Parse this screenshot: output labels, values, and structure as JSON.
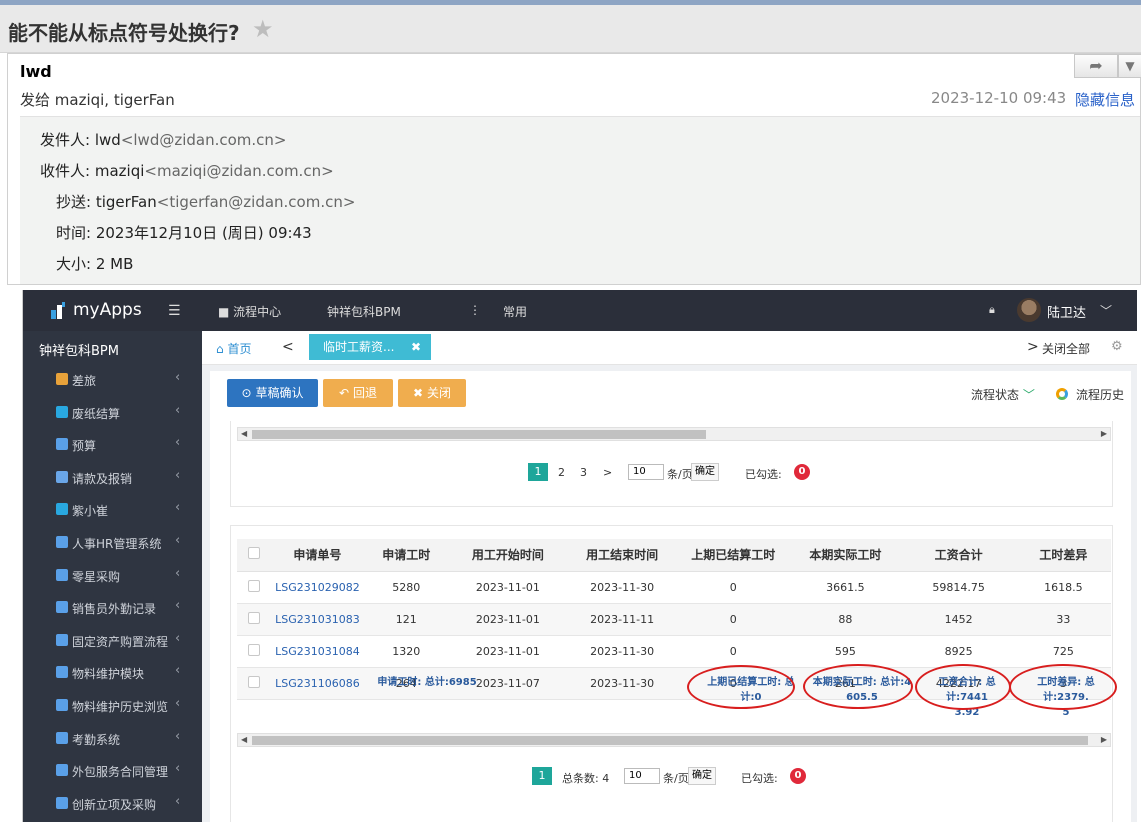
{
  "email": {
    "subject": "能不能从标点符号处换行?",
    "sender_name": "lwd",
    "recipients_line": "发给 maziqi, tigerFan",
    "date": "2023-12-10 09:43",
    "hide_info": "隐藏信息",
    "details": {
      "from_label": "发件人:",
      "from_name": "lwd",
      "from_addr": "<lwd@zidan.com.cn>",
      "to_label": "收件人:",
      "to_name": "maziqi",
      "to_addr": "<maziqi@zidan.com.cn>",
      "cc_label": "抄送:",
      "cc_name": "tigerFan",
      "cc_addr": "<tigerfan@zidan.com.cn>",
      "time_label": "时间:",
      "time_value": "2023年12月10日 (周日) 09:43",
      "size_label": "大小:",
      "size_value": "2 MB"
    }
  },
  "app": {
    "brand": "myApps",
    "nav": [
      "流程中心",
      "钟祥包科BPM",
      "常用"
    ],
    "user": "陆卫达",
    "sidebar_title": "钟祥包科BPM",
    "sidebar_items": [
      {
        "label": "差旅",
        "color": "#e8a23a"
      },
      {
        "label": "废纸结算",
        "color": "#29a8e0"
      },
      {
        "label": "预算",
        "color": "#5aa0e8"
      },
      {
        "label": "请款及报销",
        "color": "#6aa6e8"
      },
      {
        "label": "紫小崔",
        "color": "#29a8e0"
      },
      {
        "label": "人事HR管理系统",
        "color": "#5aa0e8"
      },
      {
        "label": "零星采购",
        "color": "#5aa0e8"
      },
      {
        "label": "销售员外勤记录",
        "color": "#5aa0e8"
      },
      {
        "label": "固定资产购置流程",
        "color": "#5aa0e8"
      },
      {
        "label": "物料维护模块",
        "color": "#5aa0e8"
      },
      {
        "label": "物料维护历史浏览",
        "color": "#5aa0e8"
      },
      {
        "label": "考勤系统",
        "color": "#5aa0e8"
      },
      {
        "label": "外包服务合同管理",
        "color": "#5aa0e8"
      },
      {
        "label": "创新立项及采购",
        "color": "#5aa0e8"
      }
    ],
    "tabs": {
      "home": "首页",
      "active": "临时工薪资...",
      "close_all": "关闭全部"
    },
    "toolbar": {
      "confirm": "草稿确认",
      "back": "回退",
      "close": "关闭",
      "flow_status": "流程状态",
      "flow_history": "流程历史"
    },
    "pager_top": {
      "pages": [
        "1",
        "2",
        "3"
      ],
      "next": ">",
      "page_size": "10",
      "per_page": "条/页",
      "ok": "确定",
      "selected_label": "已勾选:",
      "selected_count": "0"
    },
    "table": {
      "headers": [
        "申请单号",
        "申请工时",
        "用工开始时间",
        "用工结束时间",
        "上期已结算工时",
        "本期实际工时",
        "工资合计",
        "工时差异"
      ],
      "rows": [
        [
          "LSG231029082",
          "5280",
          "2023-11-01",
          "2023-11-30",
          "0",
          "3661.5",
          "59814.75",
          "1618.5"
        ],
        [
          "LSG231031083",
          "121",
          "2023-11-01",
          "2023-11-11",
          "0",
          "88",
          "1452",
          "33"
        ],
        [
          "LSG231031084",
          "1320",
          "2023-11-01",
          "2023-11-30",
          "0",
          "595",
          "8925",
          "725"
        ],
        [
          "LSG231106086",
          "264",
          "2023-11-07",
          "2023-11-30",
          "0",
          "261",
          "4222.17",
          "3"
        ]
      ],
      "summary": {
        "apply_hours_line1": "申请工时: 总计:6985",
        "prev_line1": "上期已结算工时: 总",
        "prev_line2": "计:0",
        "actual_line1": "本期实际工时: 总计:4",
        "actual_line2": "605.5",
        "wage_line1": "工资合计: 总计:7441",
        "wage_line2": "3.92",
        "diff_line1": "工时差异: 总计:2379.",
        "diff_line2": "5"
      }
    },
    "pager_bottom": {
      "page": "1",
      "total": "总条数: 4",
      "page_size": "10",
      "per_page": "条/页",
      "ok": "确定",
      "selected_label": "已勾选:",
      "selected_count": "0"
    }
  }
}
